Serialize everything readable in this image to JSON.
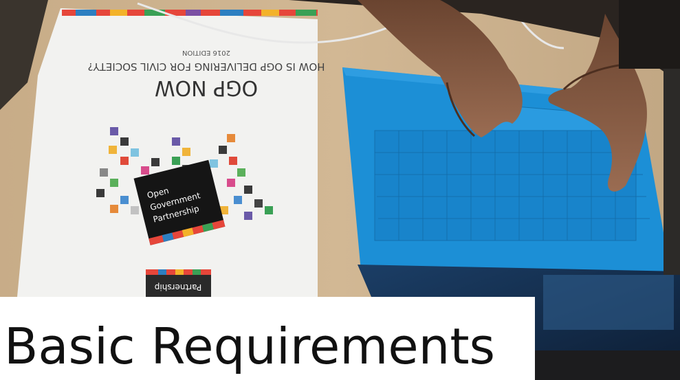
{
  "heading": "Basic Requirements",
  "booklet": {
    "title": "OGP NOW",
    "subtitle": "HOW IS OGP DELIVERING FOR CIVIL SOCIETY?",
    "edition": "2016 EDITION",
    "sticker": "Open Government Partnership",
    "footer_logo": "Partnership"
  },
  "colors": {
    "desk": "#cdb28e",
    "paper": "#f2f2f0",
    "keyboard_cover": "#1c8fd6",
    "caption_text": "#111111",
    "caption_bg": "#ffffff"
  }
}
